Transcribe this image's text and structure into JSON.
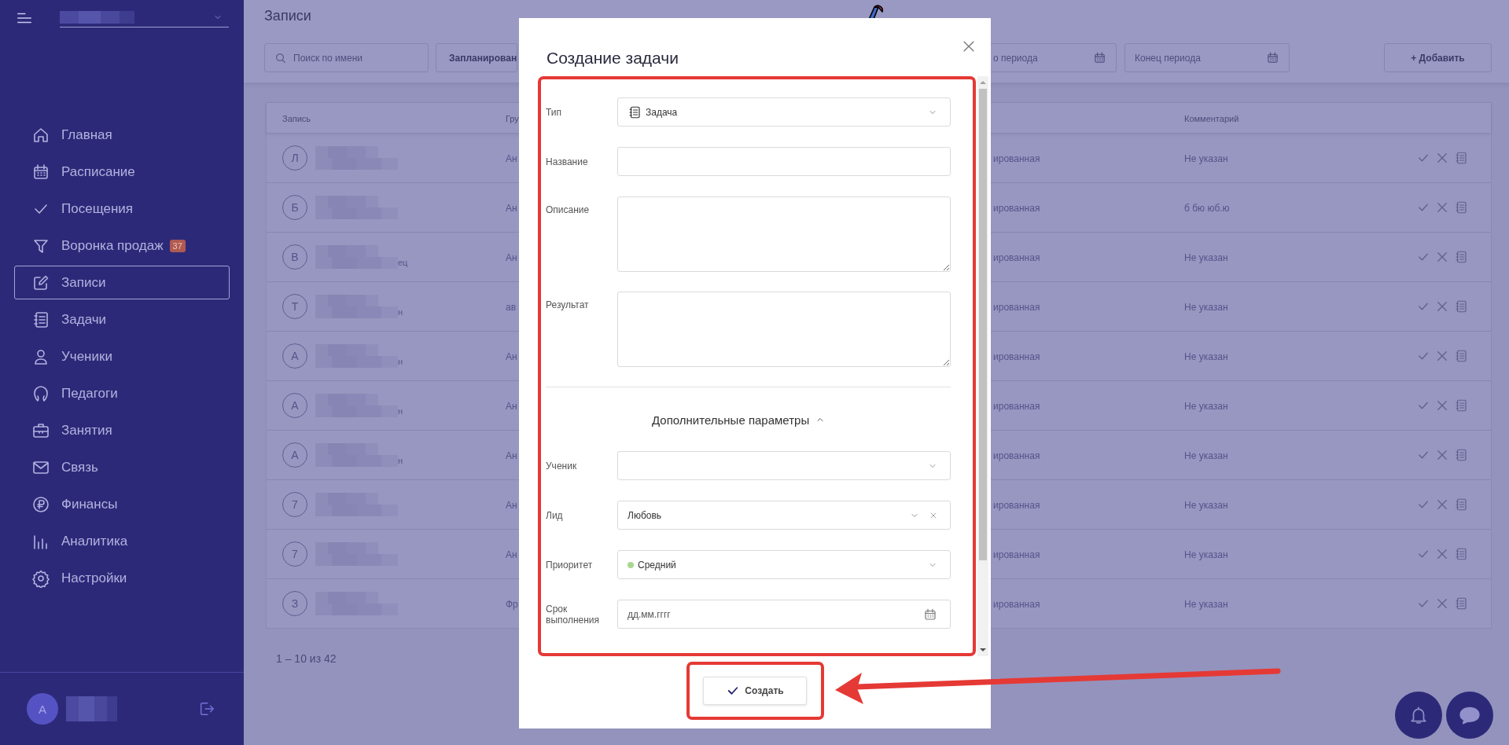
{
  "sidebar": {
    "nav_items": [
      {
        "label": "Главная",
        "selected": false
      },
      {
        "label": "Расписание",
        "selected": false
      },
      {
        "label": "Посещения",
        "selected": false
      },
      {
        "label": "Воронка продаж",
        "badge": "37",
        "selected": false
      },
      {
        "label": "Записи",
        "selected": true
      },
      {
        "label": "Задачи",
        "selected": false
      },
      {
        "label": "Ученики",
        "selected": false
      },
      {
        "label": "Педагоги",
        "selected": false
      },
      {
        "label": "Занятия",
        "selected": false
      },
      {
        "label": "Связь",
        "selected": false
      },
      {
        "label": "Финансы",
        "selected": false
      },
      {
        "label": "Аналитика",
        "selected": false
      },
      {
        "label": "Настройки",
        "selected": false
      }
    ],
    "user": {
      "avatar_letter": "A"
    }
  },
  "page": {
    "title": "Записи",
    "search": {
      "placeholder": "Поиск по имени"
    },
    "status_filter": "Запланирован",
    "period_start": {
      "placeholder": "о периода"
    },
    "period_end": {
      "placeholder": "Конец периода"
    },
    "add_button": "+ Добавить"
  },
  "table": {
    "columns": [
      "Запись",
      "Гру",
      "Комментарий"
    ],
    "rows": [
      {
        "avatar": "Л",
        "column_2": "Ан",
        "status": "ированная",
        "comment": "Не указан"
      },
      {
        "avatar": "Б",
        "column_2": "Ан",
        "status": "ированная",
        "comment": "б бю юб.ю"
      },
      {
        "avatar": "В",
        "name_tail": "ец",
        "column_2": "Ан",
        "status": "ированная",
        "comment": "Не указан"
      },
      {
        "avatar": "Т",
        "name_tail": "н",
        "column_2": "ав",
        "status": "ированная",
        "comment": "Не указан"
      },
      {
        "avatar": "А",
        "name_tail": "н",
        "column_2": "Ан",
        "status": "ированная",
        "comment": "Не указан"
      },
      {
        "avatar": "А",
        "name_tail": "н",
        "column_2": "Ан",
        "status": "ированная",
        "comment": "Не указан"
      },
      {
        "avatar": "А",
        "name_tail": "н",
        "column_2": "Ан",
        "status": "ированная",
        "comment": "Не указан"
      },
      {
        "avatar": "7",
        "column_2": "Ан",
        "status": "ированная",
        "comment": "Не указан"
      },
      {
        "avatar": "7",
        "column_2": "Ан",
        "status": "ированная",
        "comment": "Не указан"
      },
      {
        "avatar": "З",
        "column_2": "Фр",
        "status": "ированная",
        "comment": "Не указан"
      }
    ],
    "pagination": "1 – 10 из 42"
  },
  "modal": {
    "title": "Создание задачи",
    "fields": [
      {
        "kind": "type-select",
        "label": "Тип",
        "value": "Задача"
      },
      {
        "kind": "text",
        "label": "Название"
      },
      {
        "kind": "textarea",
        "label": "Описание"
      },
      {
        "kind": "textarea",
        "label": "Результат"
      }
    ],
    "extra_toggle": {
      "label": "Дополнительные параметры",
      "expanded": true
    },
    "extra_fields": [
      {
        "kind": "select",
        "label": "Ученик"
      },
      {
        "kind": "clearable-select",
        "label": "Лид",
        "value": "Любовь"
      },
      {
        "kind": "priority-select",
        "label": "Приоритет",
        "value": "Средний",
        "color": "#a8d88f"
      },
      {
        "kind": "date",
        "label": "Срок выполнения",
        "placeholder": "дд.мм.гггг"
      }
    ],
    "submit_button": "Создать"
  }
}
